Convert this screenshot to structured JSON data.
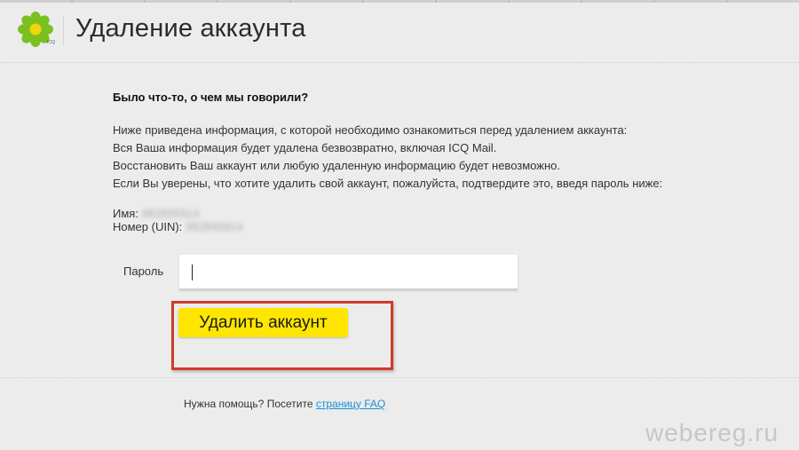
{
  "header": {
    "title": "Удаление аккаунта",
    "logo_subtext": "ICQ"
  },
  "content": {
    "question": "Было что-то, о чем мы говорили?",
    "info_lines": [
      "Ниже приведена информация, с которой необходимо ознакомиться перед удалением аккаунта:",
      "Вся Ваша информация будет удалена безвозвратно, включая ICQ Mail.",
      "Восстановить Ваш аккаунт или любую удаленную информацию будет невозможно.",
      "Если Вы уверены, что хотите удалить свой аккаунт, пожалуйста, подтвердите это, введя пароль ниже:"
    ],
    "name_label": "Имя:",
    "name_value": "982895914",
    "uin_label": "Номер (UIN):",
    "uin_value": "982895914"
  },
  "form": {
    "password_label": "Пароль",
    "password_value": "",
    "delete_button_label": "Удалить аккаунт"
  },
  "footer": {
    "help_text": "Нужна помощь? Посетите ",
    "faq_link_text": "страницу FAQ"
  },
  "watermark": "webereg.ru",
  "colors": {
    "background": "#ececec",
    "button": "#ffe600",
    "highlight": "#cf3b2c",
    "link": "#1a8fd6",
    "logo_petals": "#7ac01f",
    "logo_center": "#f2d40c"
  }
}
